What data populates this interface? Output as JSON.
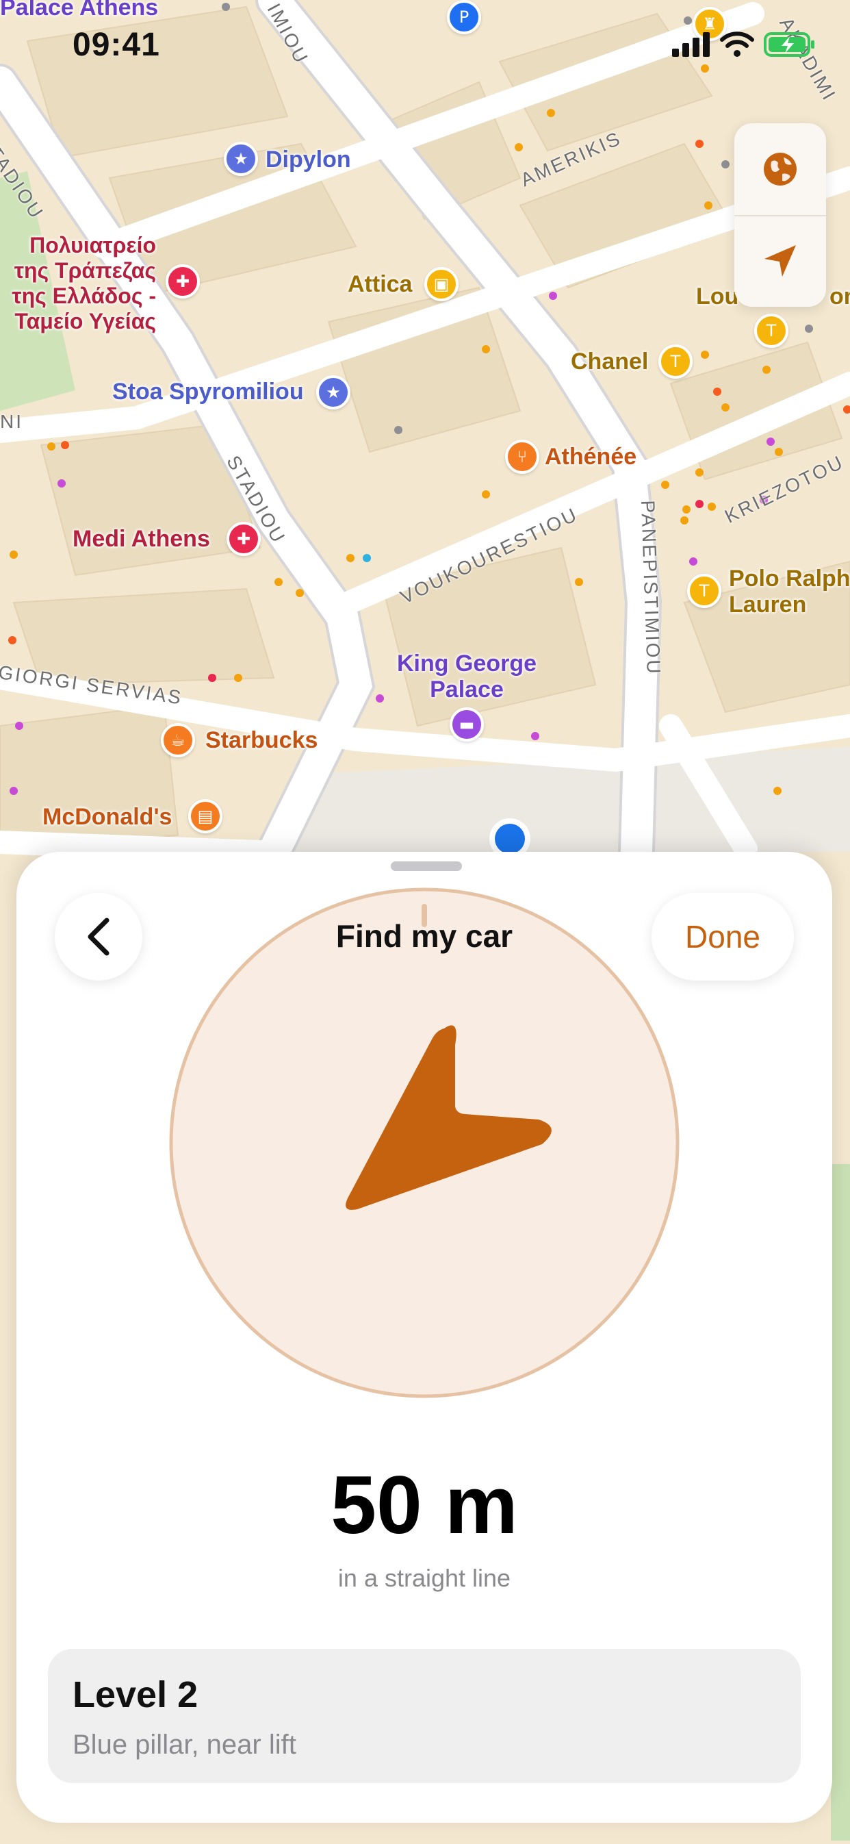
{
  "status_bar": {
    "time": "09:41"
  },
  "map": {
    "places": {
      "palace_athens": "Palace Athens",
      "dipylon": "Dipylon",
      "hospital": [
        "Πολυιατρείο",
        "της Τράπεζας",
        "της Ελλάδος -",
        "Ταμείο Υγείας"
      ],
      "attica": "Attica",
      "stoa_spyromiliou": "Stoa Spyromiliou",
      "chanel": "Chanel",
      "athenee": "Athénée",
      "medi_athens": "Medi Athens",
      "louis": "Lou",
      "louis_tail": "on",
      "polo": [
        "Polo Ralph",
        "Lauren"
      ],
      "king_george": [
        "King George",
        "Palace"
      ],
      "starbucks": "Starbucks",
      "mcdonalds": "McDonald's"
    },
    "streets": {
      "stadiou_1": "STADIOU",
      "stadiou_2": "STADIOU",
      "amerikis": "AMERIKIS",
      "voukourestiou": "VOUKOURESTIOU",
      "panepistimiou": "PANEPISTIMIOU",
      "kriezotou": "KRIEZOTOU",
      "georgi_servias": "GIORGI SERVIAS",
      "akadimias": "AKADIMI",
      "imiou": "IMIOU",
      "ni": "NI"
    },
    "controls": [
      "globe-icon",
      "location-arrow-icon"
    ]
  },
  "sheet": {
    "title": "Find my car",
    "done_label": "Done",
    "distance": "50 m",
    "distance_caption": "in a straight line",
    "level": {
      "title": "Level 2",
      "subtitle": "Blue pillar, near lift"
    }
  },
  "colors": {
    "accent": "#c46210",
    "compass_fill": "#f8ece3",
    "compass_ring": "#e6c2a4",
    "map_base": "#f3e7cf",
    "road": "#ffffff"
  }
}
